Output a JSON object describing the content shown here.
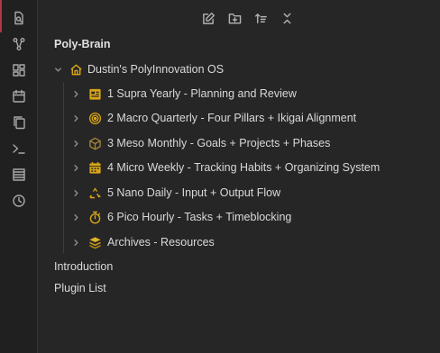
{
  "ribbon": {
    "items": [
      {
        "icon": "files-search-icon"
      },
      {
        "icon": "graph-view-icon"
      },
      {
        "icon": "dashboard-grid-icon"
      },
      {
        "icon": "calendar-icon"
      },
      {
        "icon": "copy-icon"
      },
      {
        "icon": "terminal-icon"
      },
      {
        "icon": "list-lines-icon"
      },
      {
        "icon": "clock-icon"
      }
    ],
    "accent_color": "#b33645"
  },
  "navbar": {
    "buttons": [
      {
        "icon": "new-note-icon"
      },
      {
        "icon": "new-folder-icon"
      },
      {
        "icon": "sort-icon"
      },
      {
        "icon": "collapse-all-icon"
      }
    ]
  },
  "explorer": {
    "vault_name": "Poly-Brain",
    "root_folder": {
      "label": "Dustin's PolyInnovation OS",
      "icon": "home-icon",
      "expanded": true
    },
    "folders": [
      {
        "label": "1 Supra Yearly - Planning and Review",
        "icon": "calendar-year-icon"
      },
      {
        "label": "2 Macro Quarterly - Four Pillars + Ikigai Alignment",
        "icon": "target-icon"
      },
      {
        "label": "3 Meso Monthly - Goals + Projects + Phases",
        "icon": "cube-icon"
      },
      {
        "label": "4 Micro Weekly - Tracking Habits + Organizing System",
        "icon": "calendar-week-icon"
      },
      {
        "label": "5 Nano Daily - Input + Output Flow",
        "icon": "recycle-icon"
      },
      {
        "label": "6 Pico Hourly - Tasks + Timeblocking",
        "icon": "stopwatch-icon"
      },
      {
        "label": "Archives - Resources",
        "icon": "stack-icon"
      }
    ],
    "files": [
      {
        "label": "Introduction"
      },
      {
        "label": "Plugin List"
      }
    ],
    "icon_color": "#d9a516"
  }
}
